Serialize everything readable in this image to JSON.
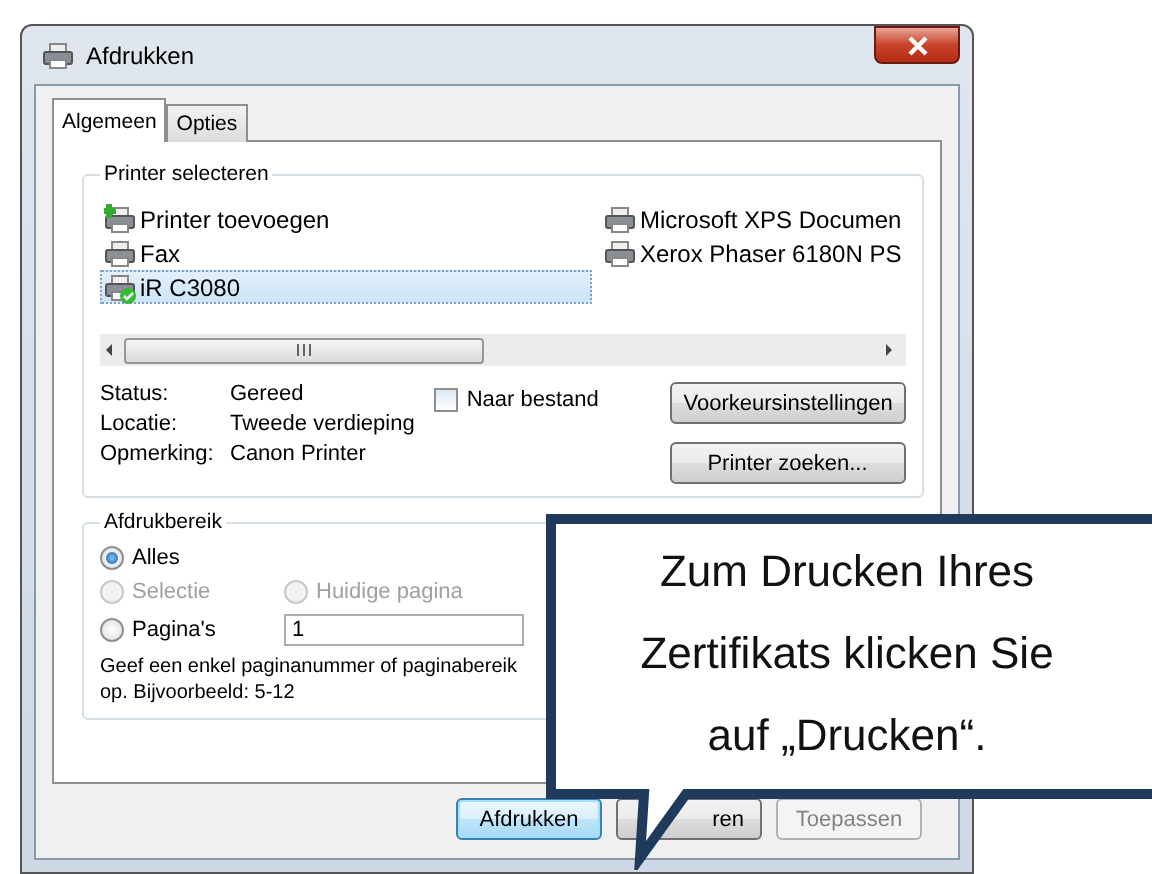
{
  "window": {
    "title": "Afdrukken"
  },
  "tabs": [
    {
      "label": "Algemeen",
      "selected": true
    },
    {
      "label": "Opties",
      "selected": false
    }
  ],
  "printer_group": {
    "title": "Printer selecteren",
    "printers": [
      {
        "name": "Printer toevoegen",
        "kind": "add",
        "selected": false
      },
      {
        "name": "Fax",
        "kind": "fax",
        "selected": false
      },
      {
        "name": "iR C3080",
        "kind": "default",
        "selected": true
      },
      {
        "name": "Microsoft XPS Documen",
        "kind": "printer",
        "selected": false
      },
      {
        "name": "Xerox Phaser 6180N PS",
        "kind": "printer",
        "selected": false
      }
    ],
    "info": [
      {
        "label": "Status:",
        "value": "Gereed"
      },
      {
        "label": "Locatie:",
        "value": "Tweede verdieping"
      },
      {
        "label": "Opmerking:",
        "value": "Canon Printer"
      }
    ],
    "to_file": {
      "label": "Naar bestand",
      "checked": false
    },
    "preferences_button": "Voorkeursinstellingen",
    "find_button": "Printer zoeken..."
  },
  "range_group": {
    "title": "Afdrukbereik",
    "options": [
      {
        "label": "Alles",
        "selected": true,
        "disabled": false
      },
      {
        "label": "Selectie",
        "selected": false,
        "disabled": true
      },
      {
        "label": "Huidige pagina",
        "selected": false,
        "disabled": true
      },
      {
        "label": "Pagina's",
        "selected": false,
        "disabled": false
      }
    ],
    "pages_value": "1",
    "hint": "Geef een enkel paginanummer of paginabereik op. Bijvoorbeeld: 5-12"
  },
  "buttons": [
    {
      "label": "Afdrukken",
      "kind": "default",
      "disabled": false
    },
    {
      "label": "ren",
      "kind": "normal",
      "disabled": false
    },
    {
      "label": "Toepassen",
      "kind": "normal",
      "disabled": true
    }
  ],
  "callout": {
    "text": "Zum Drucken Ihres Zertifikats klicken Sie auf „Drucken“."
  }
}
